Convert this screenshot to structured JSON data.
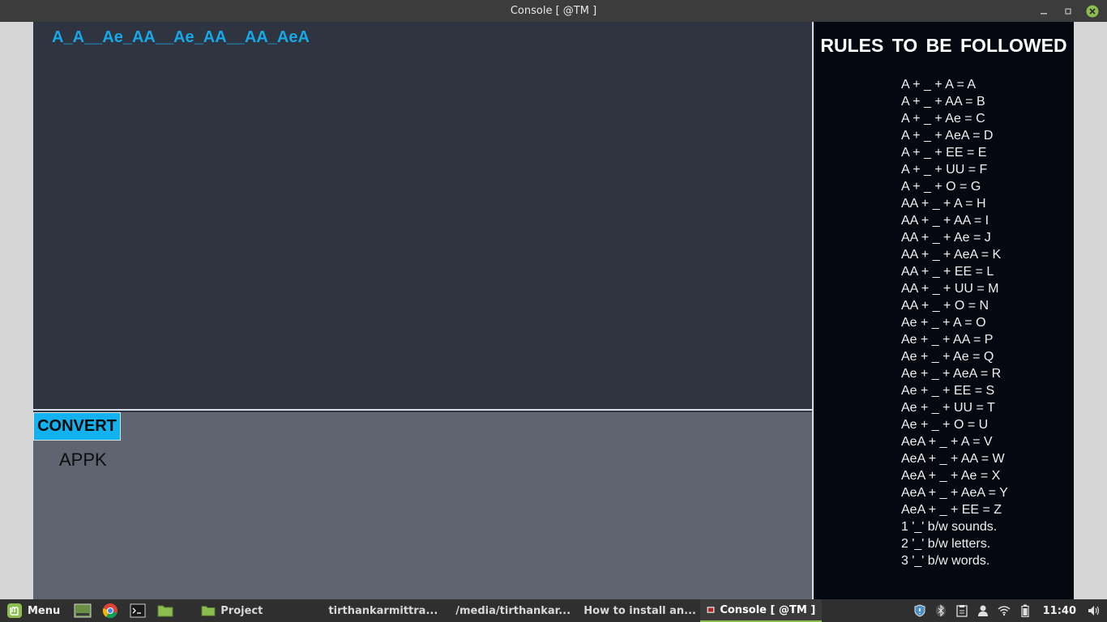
{
  "window": {
    "title": "Console [ @TM ]"
  },
  "input": {
    "text": "A_A__Ae_AA__Ae_AA__AA_AeA"
  },
  "convert_button": {
    "label": "CONVERT"
  },
  "output": {
    "text": "APPK"
  },
  "rules": {
    "title": "RULES  TO  BE  FOLLOWED",
    "items": [
      "A + _ + A = A",
      "A + _ + AA = B",
      "A + _ + Ae = C",
      "A + _ + AeA = D",
      "A + _ + EE = E",
      "A + _ + UU = F",
      "A + _ + O = G",
      "AA + _ + A = H",
      "AA + _ + AA = I",
      "AA + _ + Ae = J",
      "AA + _ + AeA = K",
      "AA + _ + EE = L",
      "AA + _ + UU = M",
      "AA + _ + O = N",
      "Ae + _ + A = O",
      "Ae + _ + AA = P",
      "Ae + _ + Ae = Q",
      "Ae + _ + AeA = R",
      "Ae + _ + EE = S",
      "Ae + _ + UU = T",
      "Ae + _ + O = U",
      "AeA + _ + A = V",
      "AeA + _ + AA = W",
      "AeA + _ + Ae = X",
      "AeA + _ + AeA = Y",
      "AeA + _ + EE = Z",
      "1 '_' b/w sounds.",
      "2 '_' b/w letters.",
      "3 '_' b/w words."
    ]
  },
  "taskbar": {
    "menu_label": "Menu",
    "tasks": [
      {
        "label": "Project",
        "icon": "folder-icon"
      },
      {
        "label": "tirthankarmittra...",
        "icon": "terminal-icon"
      },
      {
        "label": "/media/tirthankar...",
        "icon": "sublime-text-icon"
      },
      {
        "label": "How to install an...",
        "icon": "chrome-icon"
      },
      {
        "label": "Console [ @TM ]",
        "icon": "java-app-icon"
      }
    ],
    "clock": "11:40"
  },
  "colors": {
    "input_text": "#18a8e8",
    "convert_button_bg": "#12b2f0",
    "input_bg": "#2e3440",
    "output_bg": "#5e6470",
    "rules_bg": "#050811",
    "active_task_accent": "#8bbd4f"
  }
}
